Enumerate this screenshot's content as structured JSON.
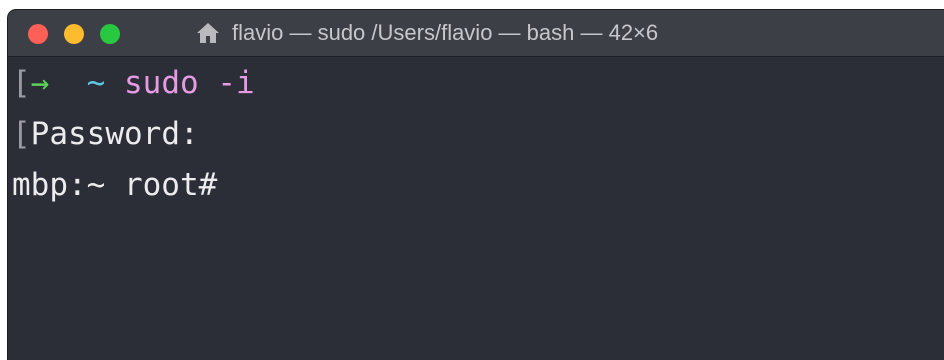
{
  "window": {
    "title": "flavio — sudo /Users/flavio — bash — 42×6",
    "buttons": {
      "close": "close",
      "minimize": "minimize",
      "maximize": "maximize"
    },
    "colors": {
      "background": "#2b2d37",
      "titlebar": "#3d3f46",
      "close": "#fe5f57",
      "minimize": "#febb2e",
      "maximize": "#28c840"
    }
  },
  "terminal": {
    "lines": [
      {
        "bracket": "[",
        "arrow": "→",
        "tilde": "~",
        "command": "sudo -i"
      },
      {
        "bracket": "[",
        "text": "Password:"
      },
      {
        "text": "mbp:~ root#"
      }
    ],
    "colors": {
      "arrow": "#5ad35a",
      "tilde": "#5fc7e6",
      "command": "#e79be4",
      "text": "#ececee"
    }
  }
}
